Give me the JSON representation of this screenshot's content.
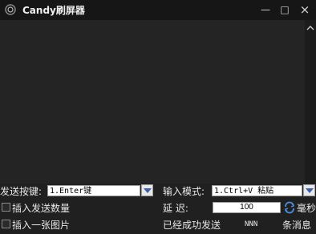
{
  "window": {
    "title": "Candy刷屏器",
    "minimize_glyph": "—",
    "maximize_glyph": "□",
    "close_glyph": "×"
  },
  "send_key": {
    "label": "发送按键:",
    "value": "1.Enter键"
  },
  "input_mode": {
    "label": "输入模式:",
    "value": "1.Ctrl+V 粘贴"
  },
  "options": {
    "insert_count_label": "插入发送数量",
    "insert_image_label": "插入一张图片"
  },
  "delay": {
    "label": "延    迟:",
    "value": "100",
    "unit": "毫秒"
  },
  "status": {
    "prefix": "已经成功发送",
    "count": "NNN",
    "suffix": "条消息"
  },
  "colors": {
    "accent": "#3c5ea8"
  }
}
